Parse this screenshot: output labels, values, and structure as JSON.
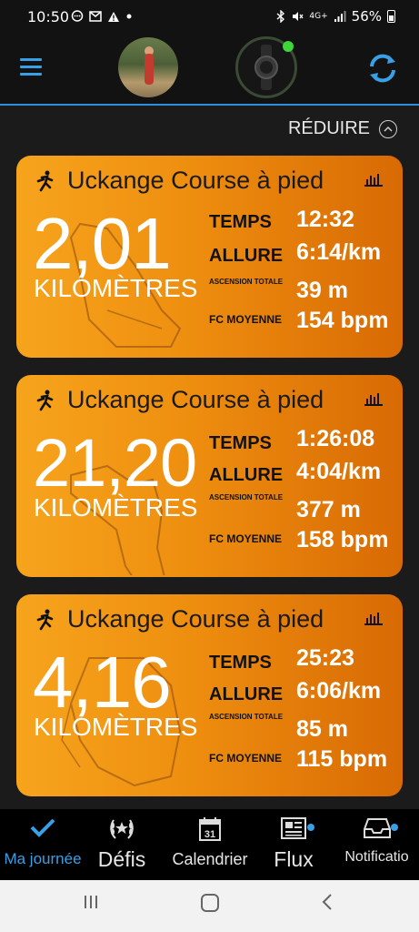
{
  "status_bar": {
    "time": "10:50",
    "battery": "56%",
    "network": "4G+"
  },
  "header": {
    "menu_icon": "hamburger-menu-icon",
    "avatar": "user-avatar",
    "device_connected": true,
    "sync_icon": "sync-icon",
    "accent_color": "#3aa0e6"
  },
  "collapse": {
    "label": "RÉDUIRE"
  },
  "activities": [
    {
      "title": "Uckange Course à pied",
      "distance": "2,01",
      "unit": "KILOMÈTRES",
      "stats": [
        {
          "label": "TEMPS",
          "value": "12:32"
        },
        {
          "label": "ALLURE",
          "value": "6:14/km"
        },
        {
          "label": "ASCENSION TOTALE",
          "value": "39 m"
        },
        {
          "label": "FC MOYENNE",
          "value": "154 bpm"
        }
      ]
    },
    {
      "title": "Uckange Course à pied",
      "distance": "21,20",
      "unit": "KILOMÈTRES",
      "stats": [
        {
          "label": "TEMPS",
          "value": "1:26:08"
        },
        {
          "label": "ALLURE",
          "value": "4:04/km"
        },
        {
          "label": "ASCENSION TOTALE",
          "value": "377 m"
        },
        {
          "label": "FC MOYENNE",
          "value": "158 bpm"
        }
      ]
    },
    {
      "title": "Uckange Course à pied",
      "distance": "4,16",
      "unit": "KILOMÈTRES",
      "stats": [
        {
          "label": "TEMPS",
          "value": "25:23"
        },
        {
          "label": "ALLURE",
          "value": "6:06/km"
        },
        {
          "label": "ASCENSION TOTALE",
          "value": "85 m"
        },
        {
          "label": "FC MOYENNE",
          "value": "115 bpm"
        }
      ]
    }
  ],
  "bottom_nav": {
    "items": [
      {
        "label": "Ma journée",
        "icon": "checkmark-icon",
        "active": true
      },
      {
        "label": "Défis",
        "icon": "laurel-icon"
      },
      {
        "label": "Calendrier",
        "icon": "calendar-icon",
        "calendar_day": "31"
      },
      {
        "label": "Flux",
        "icon": "news-feed-icon",
        "badge": true
      },
      {
        "label": "Notificatio",
        "icon": "inbox-icon",
        "badge": true
      }
    ]
  }
}
